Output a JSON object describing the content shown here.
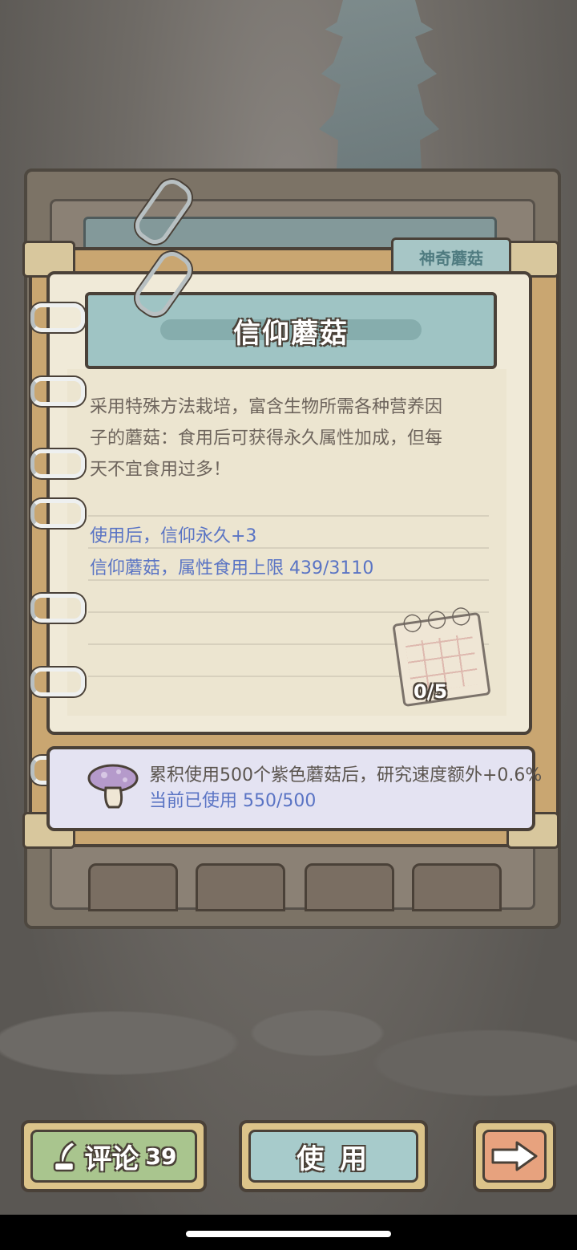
{
  "header": {
    "tab_label": "神奇蘑菇"
  },
  "item": {
    "title": "信仰蘑菇",
    "description_lines": [
      "采用特殊方法栽培，富含生物所需各种营养因",
      "子的蘑菇：食用后可获得永久属性加成，但每",
      "天不宜食用过多！"
    ],
    "effect": "使用后，信仰永久+3",
    "limit": "信仰蘑菇，属性食用上限  439/3110",
    "daily_count": "0/5"
  },
  "bonus": {
    "line1": "累积使用500个紫色蘑菇后，研究速度额外+0.6%",
    "line2": "当前已使用  550/500"
  },
  "buttons": {
    "comment_label": "评论",
    "comment_count": "39",
    "use_label": "使 用"
  },
  "colors": {
    "stat_blue": "#5a74c4",
    "desc_text": "#6d645c",
    "title_banner": "#9fc4c4",
    "comment_button": "#a9c58e",
    "use_button": "#a7cbcb",
    "next_button": "#e7a27e"
  },
  "icons": {
    "calendar": "calendar-icon",
    "mushroom": "purple-mushroom-icon",
    "quill": "quill-icon",
    "arrow": "arrow-right-icon"
  }
}
